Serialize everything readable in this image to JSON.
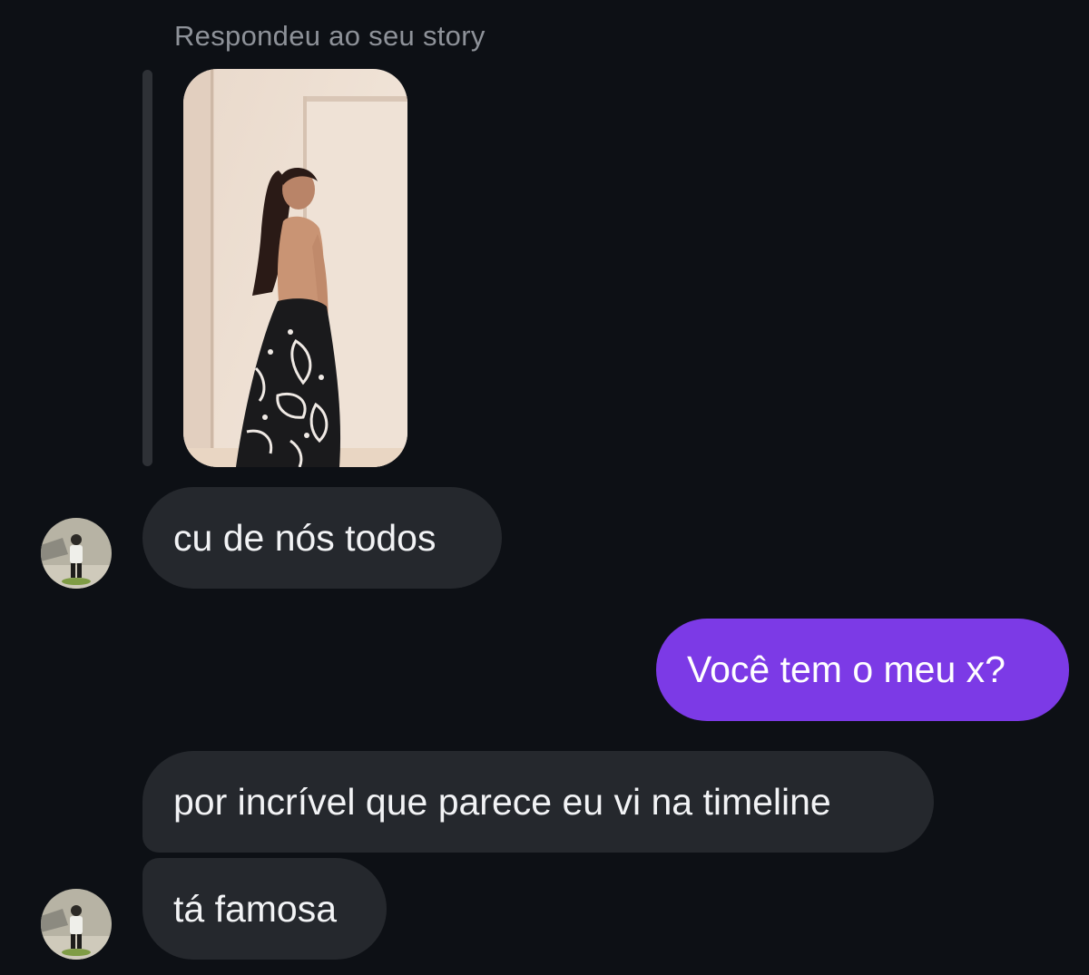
{
  "reply_header": {
    "label": "Respondeu ao seu story"
  },
  "story_preview": {
    "description_icon": "story-thumbnail-image"
  },
  "messages": [
    {
      "sender": "them",
      "text": "cu de nós todos"
    },
    {
      "sender": "me",
      "text": "Você tem o meu x?"
    },
    {
      "sender": "them",
      "text": "por incrível que parece eu vi na timeline"
    },
    {
      "sender": "them",
      "text": "tá famosa"
    }
  ],
  "colors": {
    "background": "#0d1015",
    "incoming_bubble": "#25282d",
    "outgoing_bubble": "#7c3ae6",
    "secondary_text": "#8e9299"
  }
}
